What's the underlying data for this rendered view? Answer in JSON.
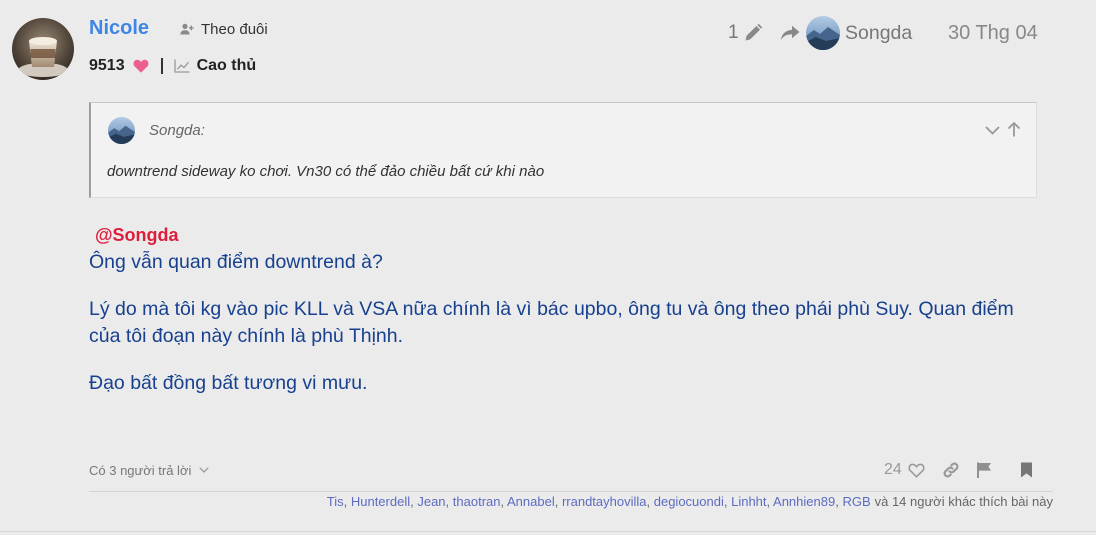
{
  "colors": {
    "page_bg": "#ebebeb",
    "username": "#3f86e4",
    "mention": "#dc1e3c",
    "body_text": "#17408f",
    "liker_link": "#5d6cc2",
    "heart": "#ec5f8c",
    "muted": "#888888"
  },
  "post": {
    "author": {
      "name": "Nicole",
      "avatar_icon": "avatar-coffee-photo",
      "follow_icon": "user-plus-icon",
      "follow_label": "Theo đuôi",
      "points": "9513",
      "points_icon": "heart-icon",
      "rank_icon": "chart-line-icon",
      "rank": "Cao thủ"
    },
    "meta": {
      "edit_count": "1",
      "edit_icon": "pencil-icon",
      "reply_icon": "reply-arrow-icon",
      "reply_to": "Songda",
      "date": "30 Thg 04"
    },
    "quote": {
      "author": "Songda:",
      "text": "downtrend sideway ko chơi. Vn30 có thể đảo chiều bất cứ khi nào",
      "expand_icon": "chevron-down-icon",
      "jump_icon": "arrow-up-icon"
    },
    "mention": "@Songda",
    "body": [
      "Ông vẫn quan điểm downtrend à?",
      "Lý do mà tôi kg vào pic KLL và VSA nữa chính là vì bác upbo, ông tu và ông theo phái phù Suy. Quan điểm của tôi đoạn này chính là phù Thịnh.",
      "Đạo bất đồng bất tương vi mưu."
    ],
    "footer": {
      "replies_label": "Có 3 người trả lời",
      "like_count": "24",
      "actions": [
        "heart-outline-icon",
        "link-icon",
        "flag-icon",
        "bookmark-icon"
      ]
    },
    "likes": {
      "names": [
        "Tis",
        "Hunterdell",
        "Jean",
        "thaotran",
        "Annabel",
        "rrandtayhovilla",
        "degiocuondi",
        "Linhht",
        "Annhien89",
        "RGB"
      ],
      "separator": ", ",
      "suffix": "và 14 người khác thích bài này"
    }
  }
}
